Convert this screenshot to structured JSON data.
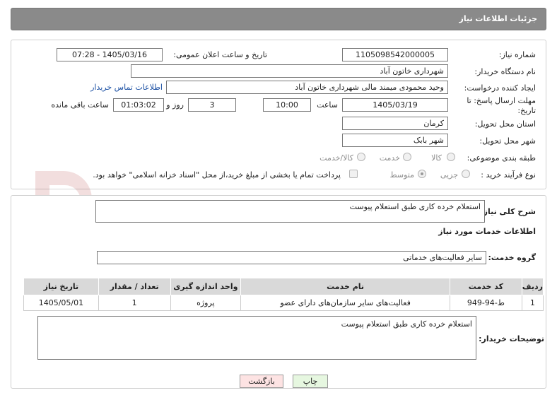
{
  "header": {
    "title": "جزئیات اطلاعات نیاز"
  },
  "form": {
    "need_number_label": "شماره نیاز:",
    "need_number": "1105098542000005",
    "announce_label": "تاریخ و ساعت اعلان عمومی:",
    "announce_value": "1405/03/16 - 07:28",
    "buyer_org_label": "نام دستگاه خریدار:",
    "buyer_org": "شهرداری خاتون آباد",
    "creator_label": "ایجاد کننده درخواست:",
    "creator": "وحید محمودی میمند مالی شهرداری خاتون آباد",
    "contact_link": "اطلاعات تماس خریدار",
    "deadline_label_1": "مهلت ارسال پاسخ: تا",
    "deadline_label_2": "تاریخ:",
    "deadline_date": "1405/03/19",
    "time_label": "ساعت",
    "deadline_time": "10:00",
    "days_value": "3",
    "days_label": "روز و",
    "remaining_value": "01:03:02",
    "remaining_label": "ساعت باقی مانده",
    "province_label": "استان محل تحویل:",
    "province": "کرمان",
    "city_label": "شهر محل تحویل:",
    "city": "شهر بابک",
    "category_label": "طبقه بندی موضوعی:",
    "category_options": [
      "کالا",
      "خدمت",
      "کالا/خدمت"
    ],
    "process_label": "نوع فرآیند خرید :",
    "process_options": [
      "جزیی",
      "متوسط"
    ],
    "payment_note": "پرداخت تمام یا بخشی از مبلغ خرید،از محل \"اسناد خزانه اسلامی\" خواهد بود."
  },
  "summary": {
    "label": "شرح کلی نیاز:",
    "value": "استعلام خرده کاری طبق استعلام پیوست"
  },
  "services": {
    "section_title": "اطلاعات خدمات مورد نیاز",
    "group_label": "گروه خدمت:",
    "group_value": "سایر فعالیت‌های خدماتی",
    "columns": [
      "ردیف",
      "کد خدمت",
      "نام خدمت",
      "واحد اندازه گیری",
      "تعداد / مقدار",
      "تاریخ نیاز"
    ],
    "rows": [
      [
        "1",
        "ط-94-949",
        "فعالیت‌های سایر سازمان‌های دارای عضو",
        "پروژه",
        "1",
        "1405/05/01"
      ]
    ]
  },
  "buyer_notes": {
    "label": "توضیحات خریدار:",
    "value": "استعلام خرده کاری طبق استعلام پیوست"
  },
  "buttons": {
    "print": "چاپ",
    "back": "بازگشت"
  },
  "watermark": {
    "text": "AriaTender.neT"
  },
  "colors": {
    "header_bg": "#8a8a8a",
    "link": "#1a4fa3",
    "back_button_bg": "#fde3e3",
    "print_button_bg": "#e6f7e0"
  }
}
